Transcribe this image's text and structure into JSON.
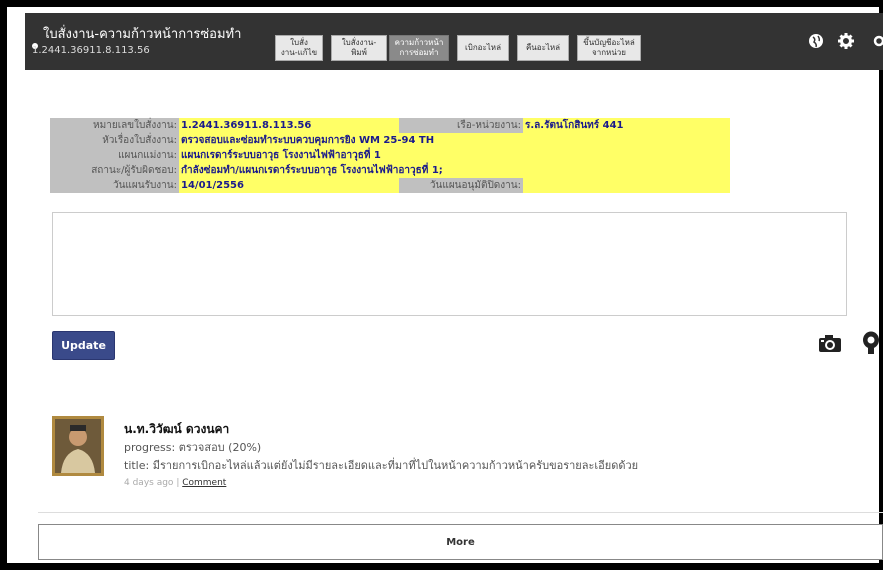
{
  "header": {
    "title": "ใบสั่งงาน-ความก้าวหน้าการซ่อมทำ",
    "subtitle": "1.2441.36911.8.113.56",
    "nav": [
      {
        "label": "ใบสั่ง\nงาน-แก้ไข",
        "active": false
      },
      {
        "label": "ใบสั่งงาน-พิมพ์",
        "active": false
      },
      {
        "label": "ความก้าวหน้า\nการซ่อมทำ",
        "active": true
      },
      {
        "label": "เบิกอะไหล่",
        "active": false
      },
      {
        "label": "คืนอะไหล่",
        "active": false
      },
      {
        "label": "ขึ้นบัญชีอะไหล่\nจากหน่วย",
        "active": false
      }
    ],
    "icons": [
      "globe-icon",
      "gear-icon",
      "settings-icon"
    ]
  },
  "workorder": {
    "number_label": "หมายเลขใบสั่งงาน:",
    "number_value": "1.2441.36911.8.113.56",
    "ship_label": "เรือ-หน่วยงาน:",
    "ship_value": "ร.ล.รัตนโกสินทร์ 441",
    "subject_label": "หัวเรื่องใบสั่งงาน:",
    "subject_value": "ตรวจสอบและซ่อมทำระบบควบคุมการยิง WM 25-94 TH",
    "dept_label": "แผนกแม่งาน:",
    "dept_value": "แผนกเรดาร์ระบบอาวุธ โรงงานไฟฟ้าอาวุธที่ 1",
    "status_label": "สถานะ/ผู้รับผิดชอบ:",
    "status_value": "กำลังซ่อมทำ/แผนกเรดาร์ระบบอาวุธ โรงงานไฟฟ้าอาวุธที่ 1;",
    "received_label": "วันแผนรับงาน:",
    "received_value": "14/01/2556",
    "approve_label": "วันแผนอนุมัติปิดงาน:",
    "approve_value": ""
  },
  "form": {
    "note_value": "",
    "update_label": "Update",
    "icons": [
      "camera-icon",
      "audio-icon"
    ]
  },
  "feed": {
    "items": [
      {
        "name": "น.ท.วิวัฒน์ ดวงนคา",
        "progress": "progress: ตรวจสอบ (20%)",
        "title": "title: มีรายการเบิกอะไหล่แล้วแต่ยังไม่มีรายละเอียดและที่มาที่ไปในหน้าความก้าวหน้าครับขอรายละเอียดด้วย",
        "time": "4 days ago",
        "separator": "|",
        "comment_label": "Comment"
      }
    ],
    "more_label": "More"
  },
  "colors": {
    "header_bg": "#333333",
    "label_bg": "#c0c0c0",
    "value_bg": "#ffff66",
    "value_text": "#1a1a8c",
    "update_bg": "#3a4a8a"
  }
}
